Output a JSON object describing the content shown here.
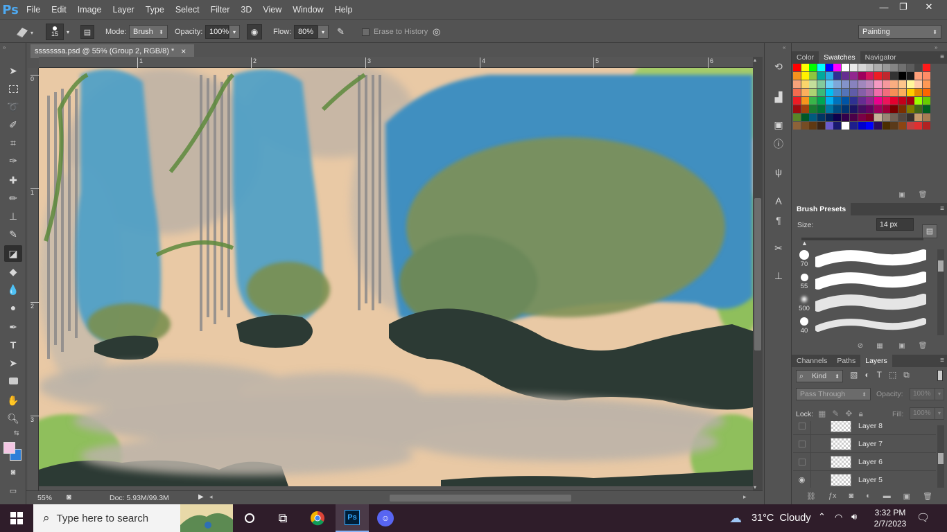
{
  "app": {
    "logo": "Ps",
    "menu": [
      "File",
      "Edit",
      "Image",
      "Layer",
      "Type",
      "Select",
      "Filter",
      "3D",
      "View",
      "Window",
      "Help"
    ],
    "window_controls": {
      "minimize": "—",
      "restore": "❐",
      "close": "✕"
    }
  },
  "options": {
    "brush_size": "15",
    "mode_label": "Mode:",
    "mode_value": "Brush",
    "opacity_label": "Opacity:",
    "opacity_value": "100%",
    "flow_label": "Flow:",
    "flow_value": "80%",
    "erase_history_label": "Erase to History",
    "workspace": "Painting"
  },
  "document": {
    "tab_title": "sssssssa.psd @ 55% (Group 2, RGB/8) *",
    "tab_close": "×",
    "ruler_top_labels": [
      "1",
      "2",
      "3",
      "4",
      "5",
      "6"
    ],
    "ruler_left_labels": [
      "0",
      "1",
      "2",
      "3"
    ],
    "zoom": "55%",
    "doc_size": "Doc: 5.93M/99.3M"
  },
  "panels": {
    "color_tabs": [
      "Color",
      "Swatches",
      "Navigator"
    ],
    "active_color_tab": "Swatches",
    "swatch_colors": [
      "#ff0000",
      "#ffff00",
      "#00ff00",
      "#00ffff",
      "#0000ff",
      "#ff00ff",
      "#ffffff",
      "#ebebeb",
      "#d6d6d6",
      "#c2c2c2",
      "#adadad",
      "#999999",
      "#858585",
      "#707070",
      "#5c5c5c",
      "#474747",
      "#ff1a1a",
      "#f7931e",
      "#fff200",
      "#8cc63f",
      "#00a99d",
      "#29abe2",
      "#2e3192",
      "#662d91",
      "#92278f",
      "#9e005d",
      "#d4145a",
      "#ed1c24",
      "#c1272d",
      "#333333",
      "#000000",
      "#1a1a1a",
      "#ffa07a",
      "#ff8c66",
      "#f5a27a",
      "#fbd56b",
      "#c4df9b",
      "#82ca9c",
      "#6dcff6",
      "#7ea7d8",
      "#8493ca",
      "#8882be",
      "#a187be",
      "#bc8dbf",
      "#f49ac2",
      "#f6989d",
      "#f9ad81",
      "#fdc68a",
      "#fff79a",
      "#fca",
      "#ff9955",
      "#f26c4f",
      "#fbaf5d",
      "#acd373",
      "#3bb878",
      "#00bff3",
      "#448ccb",
      "#5574b9",
      "#605ca8",
      "#855fa8",
      "#a763a8",
      "#f06eaa",
      "#f26d7d",
      "#f68e56",
      "#fbaf5d",
      "#ffcc00",
      "#e68a00",
      "#ff6600",
      "#ed1c24",
      "#f7941d",
      "#39b54a",
      "#00a651",
      "#00aeef",
      "#0072bc",
      "#0054a6",
      "#2e3192",
      "#662d91",
      "#92278f",
      "#ec008c",
      "#ed145b",
      "#e5002e",
      "#c4001a",
      "#a3000f",
      "#99ff00",
      "#66cc00",
      "#9e0b0f",
      "#a0410d",
      "#197b30",
      "#007236",
      "#0076a3",
      "#004b80",
      "#003471",
      "#1b1464",
      "#440e62",
      "#630460",
      "#9e005d",
      "#9e0039",
      "#790000",
      "#7b2e00",
      "#827b00",
      "#406618",
      "#005e20",
      "#598527",
      "#005826",
      "#005b7f",
      "#003663",
      "#002157",
      "#0d004c",
      "#32004b",
      "#4b0049",
      "#7b0046",
      "#7a0026",
      "#c7b299",
      "#998675",
      "#736357",
      "#534741",
      "#37302d",
      "#c69c6d",
      "#a67c52",
      "#8c6239",
      "#754c24",
      "#603913",
      "#3c2415",
      "#6a5acd",
      "#191970",
      "#ffffff",
      "#1e1e8c",
      "#0000cd",
      "#0000ff",
      "#2a0a5e",
      "#4b2d00",
      "#5a3a1a",
      "#8b4513",
      "#c04040",
      "#e03030",
      "#b22222"
    ],
    "brush_presets_title": "Brush Presets",
    "size_label": "Size:",
    "size_value": "14 px",
    "brushes": [
      {
        "size": "70"
      },
      {
        "size": "55"
      },
      {
        "size": "500"
      },
      {
        "size": "40"
      }
    ],
    "layer_tabs": [
      "Channels",
      "Paths",
      "Layers"
    ],
    "active_layer_tab": "Layers",
    "kind_label": "Kind",
    "blend_mode": "Pass Through",
    "opacity_label": "Opacity:",
    "opacity_value": "100%",
    "lock_label": "Lock:",
    "fill_label": "Fill:",
    "fill_value": "100%",
    "layers": [
      {
        "name": "Layer 8",
        "visible": false
      },
      {
        "name": "Layer 7",
        "visible": false
      },
      {
        "name": "Layer 6",
        "visible": false
      },
      {
        "name": "Layer 5",
        "visible": true
      }
    ]
  },
  "taskbar": {
    "search_placeholder": "Type here to search",
    "weather": "31°C  Cloudy",
    "time": "3:32 PM",
    "date": "2/7/2023"
  }
}
